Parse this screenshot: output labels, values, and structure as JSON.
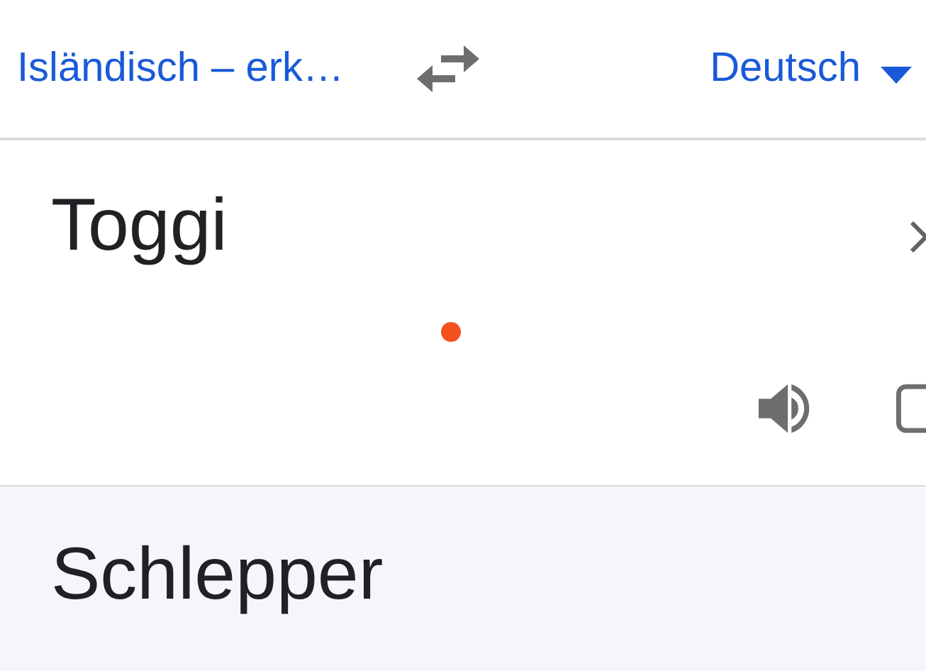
{
  "language_bar": {
    "source_language": "Isländisch – erk…",
    "target_language": "Deutsch"
  },
  "input": {
    "text": "Toggi"
  },
  "output": {
    "text": "Schlepper"
  }
}
